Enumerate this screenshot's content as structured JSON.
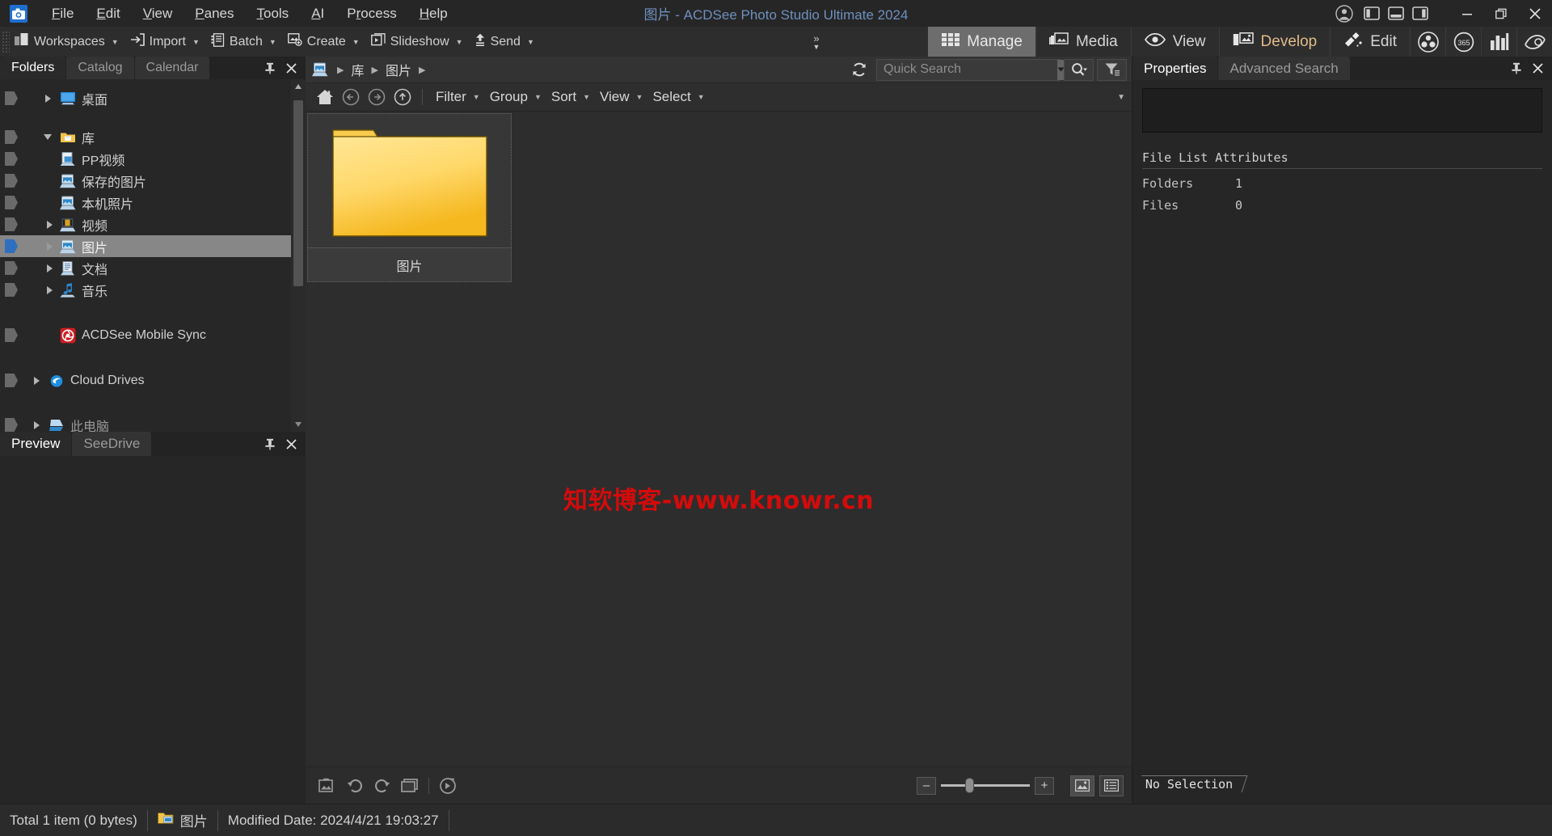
{
  "window": {
    "title": "图片 - ACDSee Photo Studio Ultimate 2024",
    "logo_icon": "camera-icon",
    "account_icon": "user-account-icon",
    "layout_icons": [
      "layout-left-icon",
      "layout-bottom-icon",
      "layout-right-icon"
    ],
    "minimize_label": "–",
    "restore_label": "❐",
    "close_label": "✕"
  },
  "menubar": {
    "items": [
      {
        "label": "File",
        "accel": "F"
      },
      {
        "label": "Edit",
        "accel": "E"
      },
      {
        "label": "View",
        "accel": "V"
      },
      {
        "label": "Panes",
        "accel": "P"
      },
      {
        "label": "Tools",
        "accel": "T"
      },
      {
        "label": "AI",
        "accel": "A"
      },
      {
        "label": "Process",
        "accel": "r"
      },
      {
        "label": "Help",
        "accel": "H"
      }
    ]
  },
  "toolbar": {
    "items": [
      {
        "label": "Workspaces",
        "icon": "workspaces-icon",
        "dropdown": true
      },
      {
        "label": "Import",
        "icon": "import-icon",
        "dropdown": true
      },
      {
        "label": "Batch",
        "icon": "batch-icon",
        "dropdown": true
      },
      {
        "label": "Create",
        "icon": "create-icon",
        "dropdown": true
      },
      {
        "label": "Slideshow",
        "icon": "slideshow-icon",
        "dropdown": true
      },
      {
        "label": "Send",
        "icon": "send-icon",
        "dropdown": true
      }
    ],
    "overflow_label": "»"
  },
  "modes": {
    "tabs": [
      {
        "label": "Manage",
        "icon": "grid-icon",
        "active": true
      },
      {
        "label": "Media",
        "icon": "media-icon",
        "active": false
      },
      {
        "label": "View",
        "icon": "eye-icon",
        "active": false
      },
      {
        "label": "Develop",
        "icon": "develop-icon",
        "active": false
      },
      {
        "label": "Edit",
        "icon": "edit-brush-icon",
        "active": false
      }
    ],
    "extra_icons": [
      "people-icon",
      "365-icon",
      "chart-icon",
      "acdsee-refresh-icon"
    ]
  },
  "left_panel": {
    "tabs": [
      {
        "label": "Folders",
        "active": true
      },
      {
        "label": "Catalog",
        "active": false
      },
      {
        "label": "Calendar",
        "active": false
      }
    ],
    "pin_icon": "pin-icon",
    "close_icon": "close-icon",
    "tree": [
      {
        "label": "桌面",
        "icon": "desktop-icon",
        "indent": 1,
        "expander": "collapsed",
        "selected": false
      },
      {
        "label": "",
        "icon": "",
        "indent": 0,
        "expander": "none",
        "spacer": true,
        "selected": false
      },
      {
        "label": "库",
        "icon": "library-folder-icon",
        "indent": 1,
        "expander": "expanded",
        "selected": false
      },
      {
        "label": "PP视频",
        "icon": "video-folder-icon",
        "indent": 2,
        "expander": "none",
        "selected": false
      },
      {
        "label": "保存的图片",
        "icon": "pictures-icon",
        "indent": 2,
        "expander": "none",
        "selected": false
      },
      {
        "label": "本机照片",
        "icon": "pictures-icon",
        "indent": 2,
        "expander": "none",
        "selected": false
      },
      {
        "label": "视频",
        "icon": "videos-icon",
        "indent": 2,
        "expander": "collapsed",
        "selected": false
      },
      {
        "label": "图片",
        "icon": "pictures-icon",
        "indent": 2,
        "expander": "collapsed",
        "selected": true
      },
      {
        "label": "文档",
        "icon": "documents-icon",
        "indent": 2,
        "expander": "collapsed",
        "selected": false
      },
      {
        "label": "音乐",
        "icon": "music-icon",
        "indent": 2,
        "expander": "collapsed",
        "selected": false
      },
      {
        "label": "",
        "icon": "",
        "indent": 0,
        "expander": "none",
        "spacer": true,
        "selected": false
      },
      {
        "label": "ACDSee Mobile Sync",
        "icon": "acdsee-mobile-sync-icon",
        "indent": 2,
        "expander": "none",
        "selected": false
      },
      {
        "label": "",
        "icon": "",
        "indent": 0,
        "expander": "none",
        "spacer": true,
        "selected": false
      },
      {
        "label": "Cloud Drives",
        "icon": "cloud-drives-icon",
        "indent": 1,
        "expander": "collapsed",
        "selected": false
      }
    ]
  },
  "preview_panel": {
    "tabs": [
      {
        "label": "Preview",
        "active": true
      },
      {
        "label": "SeeDrive",
        "active": false
      }
    ],
    "pin_icon": "pin-icon",
    "close_icon": "close-icon"
  },
  "center": {
    "breadcrumb": {
      "root_icon": "pictures-icon",
      "items": [
        "库",
        "图片"
      ]
    },
    "refresh_icon": "refresh-icon",
    "search": {
      "placeholder": "Quick Search",
      "value": "",
      "dropdown_icon": "chevron-down-icon",
      "search_icon": "search-icon",
      "filter_icon": "filter-funnel-icon"
    },
    "nav": {
      "home_icon": "home-icon",
      "back_icon": "back-arrow-icon",
      "forward_icon": "forward-arrow-icon",
      "up_icon": "up-arrow-icon",
      "menus": [
        "Filter",
        "Group",
        "Sort",
        "View",
        "Select"
      ],
      "overflow_icon": "chevron-down-icon"
    },
    "items": [
      {
        "label": "图片",
        "type": "folder",
        "icon": "yellow-folder-icon"
      }
    ],
    "watermark": "知软博客-www.knowr.cn",
    "bottom_toolbar": {
      "icons": [
        "image-properties-icon",
        "rotate-left-icon",
        "rotate-right-icon",
        "window-icon",
        "play-icon"
      ],
      "zoom_out_label": "–",
      "zoom_in_label": "+",
      "zoom_value": 25,
      "view_thumbnail_icon": "thumbnail-view-icon",
      "view_list_icon": "list-view-icon"
    }
  },
  "right_panel": {
    "tabs": [
      {
        "label": "Properties",
        "active": true
      },
      {
        "label": "Advanced Search",
        "active": false
      }
    ],
    "pin_icon": "pin-icon",
    "close_icon": "close-icon",
    "note_value": "",
    "section_title": "File List Attributes",
    "attributes": [
      {
        "key": "Folders",
        "value": "1"
      },
      {
        "key": "Files",
        "value": "0"
      }
    ],
    "footer": "No Selection"
  },
  "statusbar": {
    "total": "Total 1 item  (0 bytes)",
    "folder_icon": "yellow-folder-icon",
    "folder_name": "图片",
    "modified": "Modified Date: 2024/4/21 19:03:27"
  }
}
